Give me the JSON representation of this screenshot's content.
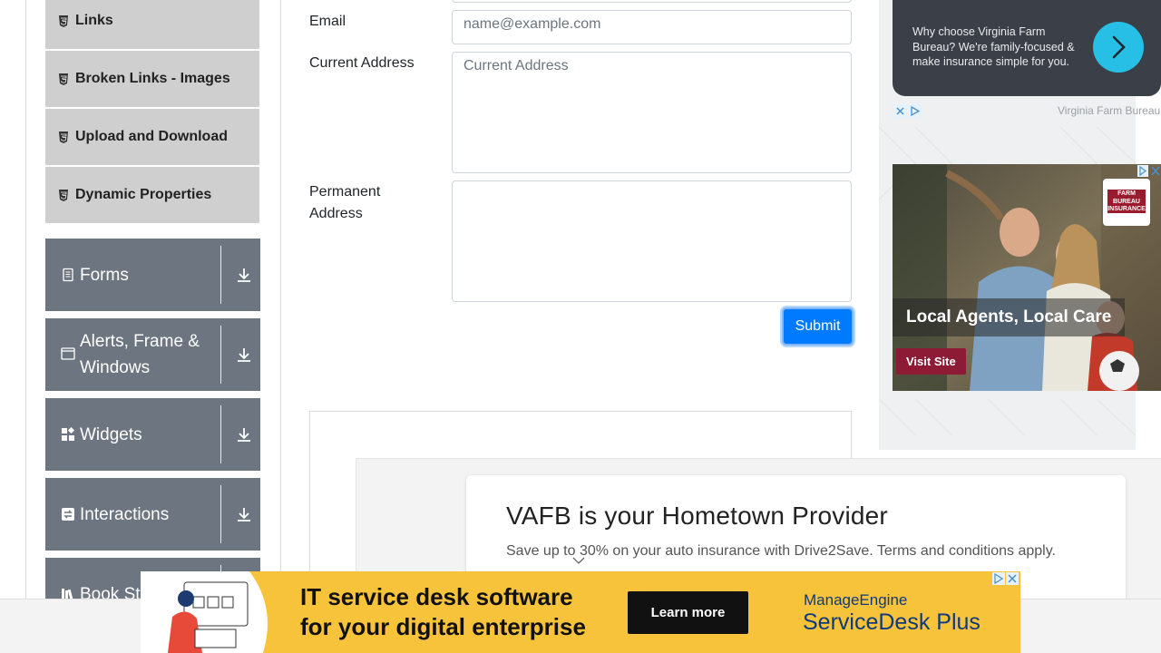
{
  "sidebar": {
    "sub_items": [
      {
        "label": "Links"
      },
      {
        "label": "Broken Links - Images"
      },
      {
        "label": "Upload and Download"
      },
      {
        "label": "Dynamic Properties"
      }
    ],
    "groups": [
      {
        "label": "Forms",
        "icon": "document-icon"
      },
      {
        "label": "Alerts, Frame & Windows",
        "icon": "window-icon"
      },
      {
        "label": "Widgets",
        "icon": "widgets-icon"
      },
      {
        "label": "Interactions",
        "icon": "interactions-icon"
      },
      {
        "label": "Book Store Application",
        "icon": "books-icon"
      }
    ]
  },
  "form": {
    "email_label": "Email",
    "email_placeholder": "name@example.com",
    "current_address_label": "Current Address",
    "current_address_placeholder": "Current Address",
    "permanent_address_label": "Permanent Address",
    "submit_label": "Submit"
  },
  "right_ad": {
    "why_text": "Why choose Virginia Farm Bureau? We're family-focused & make insurance simple for you.",
    "brand_text": "Virginia Farm Bureau",
    "caption": "Local Agents, Local Care",
    "cta": "Visit Site",
    "logo_text": "FARM BUREAU INSURANCE"
  },
  "center_ad": {
    "title": "VAFB is your Hometown Provider",
    "subtitle": "Save up to 30% on your auto insurance with Drive2Save. Terms and conditions apply."
  },
  "bottom_ad": {
    "headline_1": "IT service desk software",
    "headline_2": "for your digital enterprise",
    "cta": "Learn more",
    "brand_1": "ManageEngine",
    "brand_2": "ServiceDesk Plus"
  },
  "colors": {
    "accent": "#007bff",
    "sidebar_group": "#6d7680",
    "sidebar_sub": "#cfcfcf",
    "ad_yellow": "#f7c33a"
  }
}
